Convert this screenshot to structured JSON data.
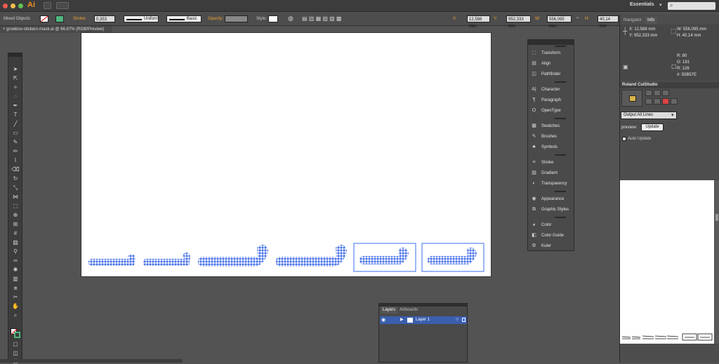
{
  "app": {
    "logo": "Ai",
    "workspace": "Essentials",
    "search_placeholder": ""
  },
  "control_bar": {
    "selection": "Mixed Objects",
    "stroke_label": "Stroke:",
    "stroke_value": "0,353",
    "stroke_unit": "mr",
    "profile": "Uniform",
    "brush": "Basic",
    "opacity_label": "Opacity:",
    "style_label": "Style:",
    "x_label": "X:",
    "x_value": "12,588 mm",
    "y_label": "Y:",
    "y_value": "952,333 mm",
    "w_label": "W:",
    "w_value": "556,095 mm",
    "h_label": "H:",
    "h_value": "40,14 mm"
  },
  "document": {
    "tab_title": "growbox-stickers-mask.ai @ 66,67% (RGB/Preview)"
  },
  "panel_stack": {
    "groups": [
      [
        "Transform",
        "Align",
        "Pathfinder"
      ],
      [
        "Character",
        "Paragraph",
        "OpenType"
      ],
      [
        "Swatches",
        "Brushes",
        "Symbols"
      ],
      [
        "Stroke",
        "Gradient",
        "Transparency"
      ],
      [
        "Appearance",
        "Graphic Styles"
      ],
      [
        "Color",
        "Color Guide",
        "Kuler"
      ]
    ]
  },
  "navigator": {
    "tab_navigator": "Navigator",
    "tab_info": "Info",
    "x": "X: 12,588 mm",
    "y": "Y: 952,333 mm",
    "w": "W: 556,095 mm",
    "h": "H: 40,14 mm",
    "r": "R: 80",
    "g": "G: 181",
    "b": "R: 126",
    "hex": "#: 50B57E"
  },
  "cutstudio": {
    "title": "Roland CutStudio",
    "output_option": "Output All Lines",
    "preview_label": "preview:",
    "update_button": "Update",
    "auto_update": "Auto Update"
  },
  "layers": {
    "tab_layers": "Layers",
    "tab_artboards": "Artboards",
    "layer_name": "Layer 1"
  },
  "colors": {
    "selection_blue": "#3a6cf0",
    "sticker_blue": "#4a74e8"
  }
}
